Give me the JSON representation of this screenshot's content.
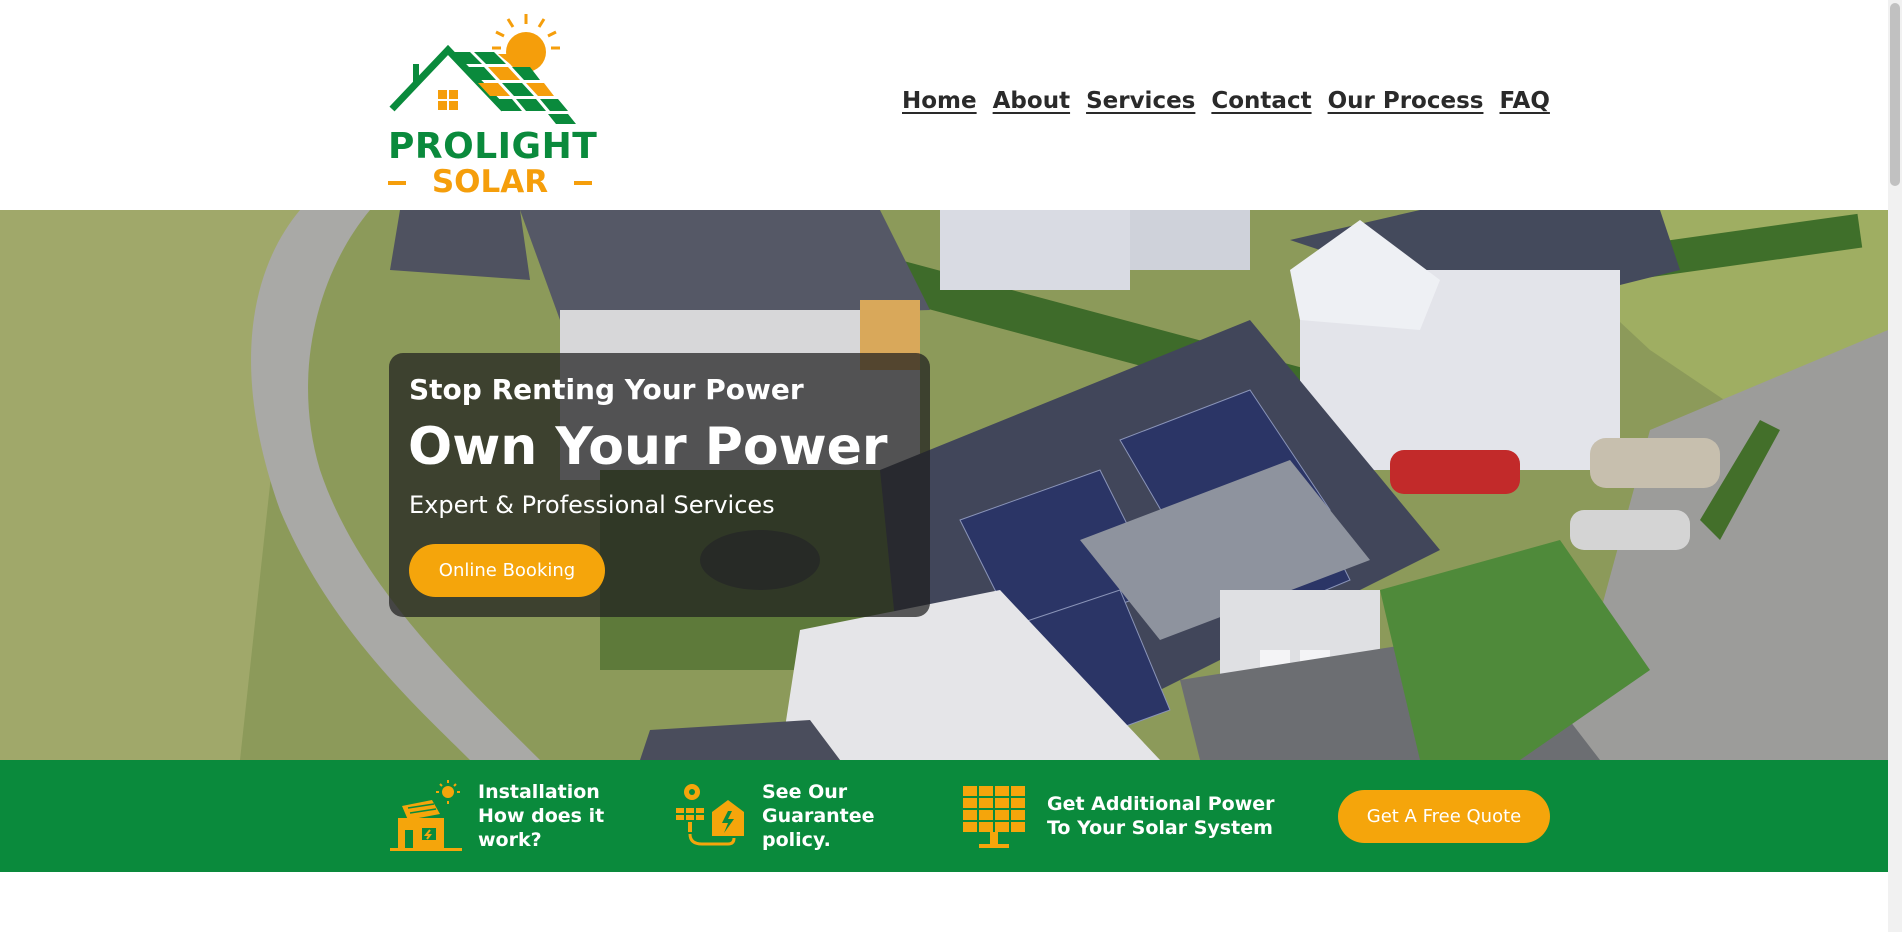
{
  "brand": {
    "name_line1": "PROLIGHT",
    "name_line2": "SOLAR",
    "colors": {
      "green": "#0a8a3c",
      "orange": "#f59e0b",
      "accent_button": "#f5a50b"
    }
  },
  "nav": {
    "items": [
      {
        "label": "Home"
      },
      {
        "label": "About"
      },
      {
        "label": "Services"
      },
      {
        "label": "Contact"
      },
      {
        "label": "Our Process"
      },
      {
        "label": "FAQ"
      }
    ]
  },
  "hero": {
    "kicker": "Stop Renting Your Power",
    "title": "Own Your Power",
    "subtitle": "Expert & Professional Services",
    "cta_label": "Online Booking"
  },
  "features": {
    "items": [
      {
        "icon": "solar-house-icon",
        "line1": "Installation",
        "line2": "How does it",
        "line3": "work?"
      },
      {
        "icon": "guarantee-solar-icon",
        "line1": "See Our",
        "line2": "Guarantee",
        "line3": "policy."
      },
      {
        "icon": "solar-panel-icon",
        "line1": "Get Additional Power",
        "line2": "To Your Solar System",
        "line3": ""
      }
    ],
    "quote_label": "Get A Free Quote"
  }
}
